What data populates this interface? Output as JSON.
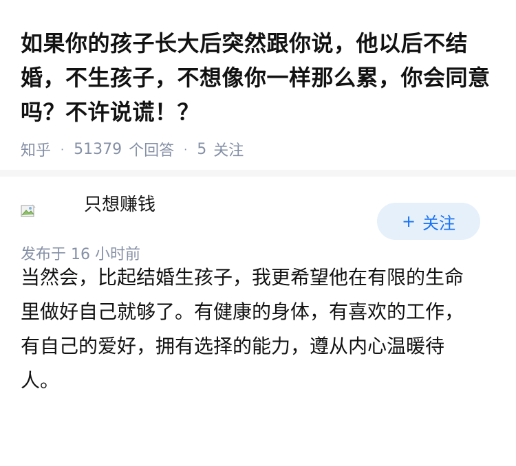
{
  "question": {
    "title": "如果你的孩子长大后突然跟你说，他以后不结婚，不生孩子，不想像你一样那么累，你会同意吗？不许说谎！？",
    "source": "知乎",
    "answer_count": "51379",
    "answer_count_label": "个回答",
    "follower_count": "5",
    "follower_count_label": "关注"
  },
  "answer": {
    "author": {
      "name": "只想赚钱",
      "avatar_alt": "avatar"
    },
    "follow_label": "关注",
    "content": "当然会，比起结婚生孩子，我更希望他在有限的生命里做好自己就够了。有健康的身体，有喜欢的工作，有自己的爱好，拥有选择的能力，遵从内心温暖待人。",
    "published": "发布于 16 小时前"
  },
  "colors": {
    "meta_gray": "#8590a6",
    "brand_blue": "#1772f6",
    "button_bg": "#e5f0fb"
  }
}
